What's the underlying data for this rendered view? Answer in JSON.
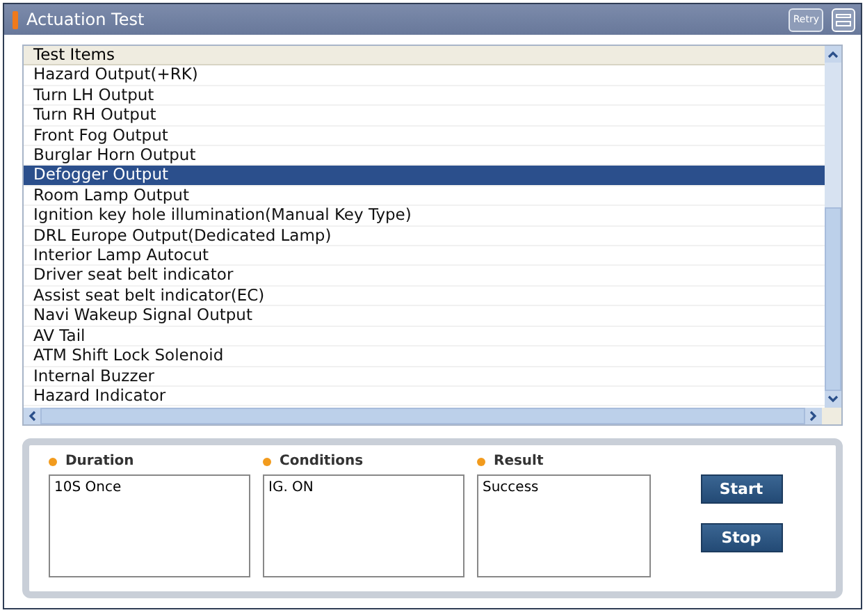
{
  "window": {
    "title": "Actuation Test",
    "retry_label": "Retry"
  },
  "table": {
    "column": "Test Items",
    "rows": [
      {
        "label": "Hazard Output(+RK)",
        "selected": false
      },
      {
        "label": "Turn LH Output",
        "selected": false
      },
      {
        "label": "Turn RH Output",
        "selected": false
      },
      {
        "label": "Front Fog Output",
        "selected": false
      },
      {
        "label": "Burglar Horn Output",
        "selected": false
      },
      {
        "label": "Defogger Output",
        "selected": true
      },
      {
        "label": "Room Lamp Output",
        "selected": false
      },
      {
        "label": "Ignition key hole illumination(Manual Key Type)",
        "selected": false
      },
      {
        "label": "DRL Europe Output(Dedicated Lamp)",
        "selected": false
      },
      {
        "label": "Interior Lamp Autocut",
        "selected": false
      },
      {
        "label": "Driver seat belt indicator",
        "selected": false
      },
      {
        "label": "Assist seat belt indicator(EC)",
        "selected": false
      },
      {
        "label": "Navi Wakeup Signal Output",
        "selected": false
      },
      {
        "label": "AV Tail",
        "selected": false
      },
      {
        "label": "ATM Shift Lock Solenoid",
        "selected": false
      },
      {
        "label": "Internal Buzzer",
        "selected": false
      },
      {
        "label": "Hazard Indicator",
        "selected": false
      }
    ]
  },
  "fields": [
    {
      "label": "Duration",
      "value": "10S Once"
    },
    {
      "label": "Conditions",
      "value": "IG. ON"
    },
    {
      "label": "Result",
      "value": "Success"
    }
  ],
  "buttons": [
    "Start",
    "Stop"
  ]
}
